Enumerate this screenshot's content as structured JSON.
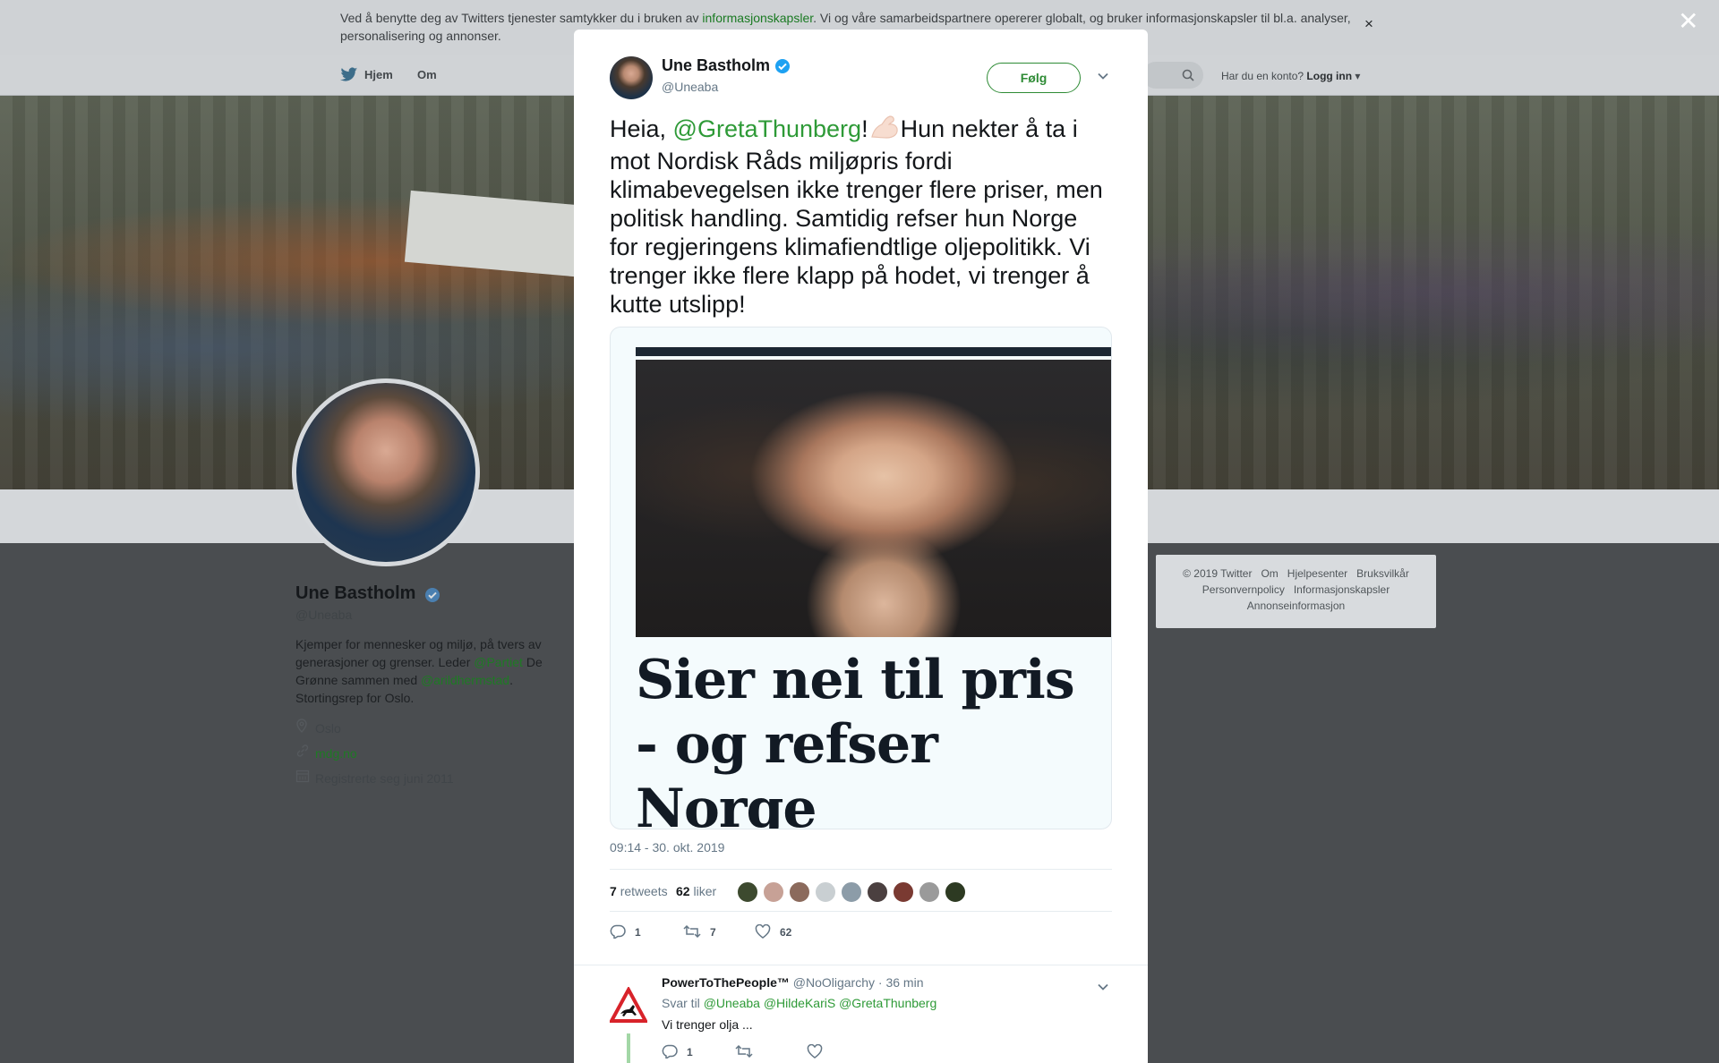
{
  "cookie_bar": {
    "text_before": "Ved å benytte deg av Twitters tjenester samtykker du i bruken av ",
    "link": "informasjonskapsler",
    "text_after": ". Vi og våre samarbeidspartnere opererer globalt, og bruker informasjonskapsler til bl.a. analyser, personalisering og annonser.",
    "close": "×"
  },
  "nav": {
    "home": "Hjem",
    "about": "Om",
    "login_prompt": "Har du en konto?",
    "login": "Logg inn"
  },
  "profile": {
    "name": "Une Bastholm",
    "handle": "@Uneaba",
    "bio_1": "Kjemper for mennesker og miljø, på tvers av generasjoner og grenser. Leder ",
    "bio_mention_1": "@Partiet",
    "bio_2": " De Grønne sammen med ",
    "bio_mention_2": "@arildhermstad",
    "bio_3": ". Stortingsrep for Oslo.",
    "location": "Oslo",
    "website": "mdg.no",
    "joined": "Registrerte seg juni 2011"
  },
  "footer": {
    "links_row1": [
      "© 2019 Twitter",
      "Om",
      "Hjelpesenter",
      "Bruksvilkår"
    ],
    "links_row2": [
      "Personvernpolicy",
      "Informasjonskapsler"
    ],
    "links_row3": [
      "Annonseinformasjon"
    ]
  },
  "overlay_close": "✕",
  "tweet": {
    "author_name": "Une Bastholm",
    "author_handle": "@Uneaba",
    "follow_label": "Følg",
    "text_prefix": "Heia, ",
    "mention": "@GretaThunberg",
    "text_bang": "!",
    "text_body": "Hun nekter å ta i mot Nordisk Råds miljøpris fordi klimabevegelsen ikke trenger flere priser, men politisk handling. Samtidig refser hun Norge for regjeringens klimafiendtlige oljepolitikk. Vi trenger ikke flere klapp på hodet, vi trenger å kutte utslipp!",
    "media_headline": "Sier nei til pris - og refser Norge",
    "timestamp": "09:14 - 30. okt. 2019",
    "retweets_count": "7",
    "retweets_label": "retweets",
    "likes_count": "62",
    "likes_label": "liker",
    "reply_count": "1",
    "retweet_count": "7",
    "like_count": "62",
    "liker_colors": [
      "#3d4a2f",
      "#c7a196",
      "#8b6a5c",
      "#c9cfd2",
      "#8c9ca8",
      "#4b4040",
      "#7a3a32",
      "#9a9a9a",
      "#2d3a22"
    ]
  },
  "reply": {
    "name": "PowerToThePeople™",
    "handle": "@NoOligarchy",
    "time": "· 36 min",
    "reply_to_label": "Svar til",
    "reply_to": [
      "@Uneaba",
      "@HildeKariS",
      "@GretaThunberg"
    ],
    "text": "Vi trenger olja ...",
    "reply_count": "1"
  },
  "colors": {
    "accent": "#2e9a37",
    "verified": "#1da1f2",
    "overlay": "#4a4d50"
  }
}
